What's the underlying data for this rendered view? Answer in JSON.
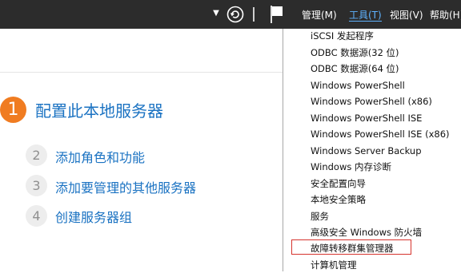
{
  "header": {
    "menus": [
      {
        "label": "管理(M)",
        "active": false
      },
      {
        "label": "工具(T)",
        "active": true
      },
      {
        "label": "视图(V)",
        "active": false
      },
      {
        "label": "帮助(H)",
        "active": false
      }
    ],
    "icons": {
      "dropdown": "chevron-down-icon",
      "refresh": "refresh-icon",
      "notifications": "flag-icon"
    }
  },
  "main": {
    "step1": {
      "number": "1",
      "label": "配置此本地服务器"
    },
    "steps": [
      {
        "number": "2",
        "label": "添加角色和功能"
      },
      {
        "number": "3",
        "label": "添加要管理的其他服务器"
      },
      {
        "number": "4",
        "label": "创建服务器组"
      }
    ]
  },
  "tools_menu": {
    "items": [
      "iSCSI 发起程序",
      "ODBC 数据源(32 位)",
      "ODBC 数据源(64 位)",
      "Windows PowerShell",
      "Windows PowerShell (x86)",
      "Windows PowerShell ISE",
      "Windows PowerShell ISE (x86)",
      "Windows Server Backup",
      "Windows 内存诊断",
      "安全配置向导",
      "本地安全策略",
      "服务",
      "高级安全 Windows 防火墙",
      "故障转移群集管理器",
      "计算机管理"
    ],
    "highlighted_item": "故障转移群集管理器"
  },
  "colors": {
    "header_bg": "#2c2c2c",
    "active_menu": "#5fb3ff",
    "link_blue": "#1a72c2",
    "step1_orange": "#f07c21",
    "highlight_red": "#d6342e"
  }
}
